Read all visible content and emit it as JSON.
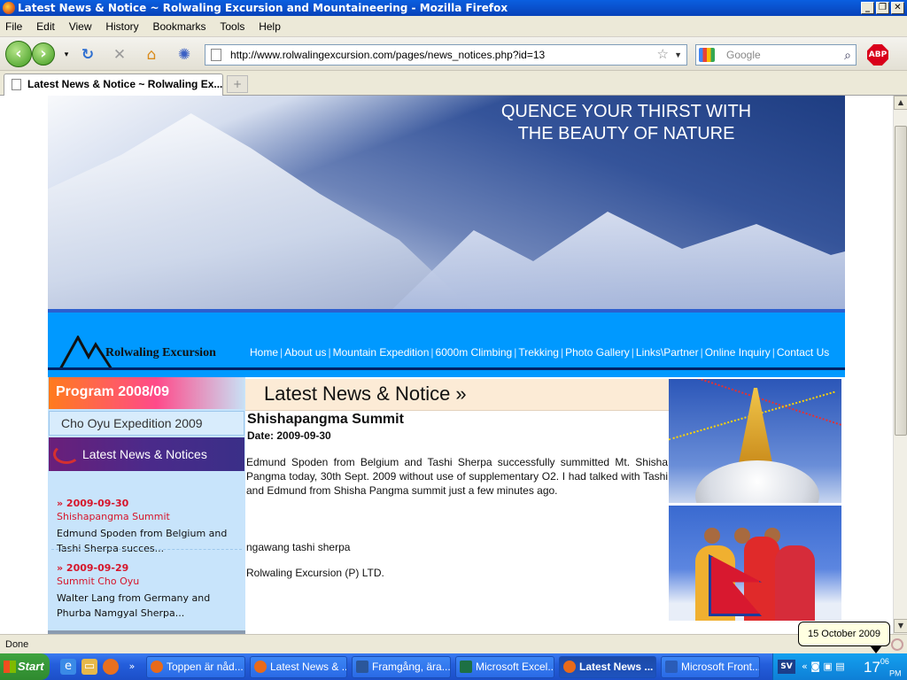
{
  "window": {
    "title": "Latest News & Notice ~ Rolwaling Excursion and Mountaineering - Mozilla Firefox",
    "controls": [
      "_",
      "❐",
      "✕"
    ]
  },
  "menu": [
    "File",
    "Edit",
    "View",
    "History",
    "Bookmarks",
    "Tools",
    "Help"
  ],
  "toolbar": {
    "back_icon": "back-arrow-icon",
    "forward_icon": "forward-arrow-icon",
    "url": "http://www.rolwalingexcursion.com/pages/news_notices.php?id=13",
    "search_placeholder": "Google",
    "abp_label": "ABP"
  },
  "tabs": [
    {
      "label": "Latest News & Notice ~ Rolwaling Ex...",
      "active": true
    }
  ],
  "newtab_label": "+",
  "site": {
    "banner_line1": "QUENCE YOUR THIRST WITH",
    "banner_line2": "THE BEAUTY OF NATURE",
    "logo_text": "Rolwaling Excursion",
    "nav": [
      "Home",
      "About us",
      "Mountain Expedition",
      "6000m Climbing",
      "Trekking",
      "Photo Gallery",
      "Links\\Partner",
      "Online Inquiry",
      "Contact Us"
    ],
    "nav_separator": "|",
    "sidebar": {
      "program_label": "Program 2008/09",
      "cho_oyu_link": "Cho Oyu Expedition 2009",
      "news_banner": "Latest News & Notices",
      "items": [
        {
          "date": "» 2009-09-30",
          "title": "Shishapangma Summit",
          "excerpt": "Edmund Spoden from Belgium and Tashi Sherpa succes..."
        },
        {
          "date": "» 2009-09-29",
          "title": "Summit Cho Oyu",
          "excerpt": "Walter Lang from Germany and Phurba Namgyal Sherpa..."
        }
      ]
    },
    "article": {
      "section_heading": "Latest News & Notice »",
      "title": "Shishapangma Summit",
      "date_line": "Date: 2009-09-30",
      "body": "Edmund Spoden from Belgium and Tashi Sherpa successfully summitted Mt. Shisha Pangma today, 30th Sept. 2009 without use of supplementary O2. I had talked with Tashi and Edmund from Shisha Pangma summit just a few minutes ago.",
      "signature": "ngawang tashi sherpa",
      "company": "Rolwaling Excursion (P) LTD."
    }
  },
  "status": {
    "text": "Done"
  },
  "taskbar": {
    "start_label": "Start",
    "buttons": [
      {
        "label": "Toppen är nåd...",
        "icon_color": "#e86a1a",
        "active": false
      },
      {
        "label": "Latest News & ...",
        "icon_color": "#e86a1a",
        "active": false
      },
      {
        "label": "Framgång, ära...",
        "icon_color": "#2b579a",
        "active": false
      },
      {
        "label": "Microsoft Excel...",
        "icon_color": "#1d7044",
        "active": false
      },
      {
        "label": "Latest News ...",
        "icon_color": "#e86a1a",
        "active": true
      },
      {
        "label": "Microsoft Front...",
        "icon_color": "#2a5cb8",
        "active": false
      }
    ],
    "tray": {
      "lang": "SV",
      "clock_hour": "17",
      "clock_min": "06",
      "clock_suffix": "PM"
    },
    "tooltip": "15 October 2009"
  }
}
